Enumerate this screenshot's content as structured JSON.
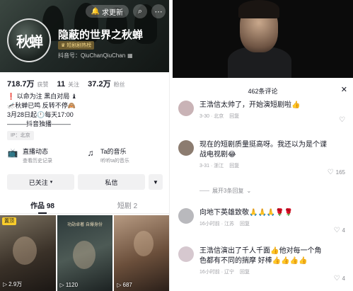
{
  "profile": {
    "top_pill": "求更新",
    "name": "隐蔽的世界之秋蝉",
    "avatar_text": "秋蝉",
    "badge": "短剧剧热榜",
    "douyin_id": "抖音号：QiuChanQiuChan",
    "stats": [
      {
        "value": "718.7万",
        "label": "获赞"
      },
      {
        "value": "11",
        "label": "关注"
      },
      {
        "value": "37.2万",
        "label": "粉丝"
      }
    ],
    "bio": [
      "❗ 以命为注 黑白对局 ♝",
      "🦟秋蝉已鸣 反转不停🙈",
      "3月28日起🕛每天17:00",
      "———抖音独播———"
    ],
    "ip": "IP：北京",
    "features": [
      {
        "title": "直播动态",
        "sub": "查看历史记录"
      },
      {
        "title": "Ta的音乐",
        "sub": "听听ta的音乐"
      }
    ],
    "buttons": {
      "follow": "已关注",
      "message": "私信"
    },
    "tabs": [
      {
        "label": "作品 98"
      },
      {
        "label": "短剧 2"
      }
    ],
    "videos": [
      {
        "pinned": "置顶",
        "plays": "2.9万"
      },
      {
        "caption": "功勋卓著 自爆身份",
        "plays": "1120"
      },
      {
        "plays": "687"
      }
    ]
  },
  "comments": {
    "header": "462条评论",
    "items": [
      {
        "text": "王浩信太帅了，开始演短剧啦👍",
        "time": "3-30",
        "location": "北京",
        "reply": "回复",
        "likes": "",
        "avatar_color": "#c9b3b6"
      },
      {
        "text": "现在的短剧质量挺高呀。我还以为是个谍战电视剧😂",
        "time": "3-31",
        "location": "浙江",
        "reply": "回复",
        "likes": "165",
        "avatar_color": "#8c7c70"
      },
      {
        "text": "向地下英雄致敬🙏🙏🙏🌹🌹",
        "time": "16小时前",
        "location": "江苏",
        "reply": "回复",
        "likes": "4",
        "avatar_color": "#b9b9bd"
      },
      {
        "text": "王浩信演出了千人千面👍他对每一个角色都有不同的揣摩 好棒👍👍👍👍",
        "time": "16小时前",
        "location": "辽宁",
        "reply": "回复",
        "likes": "4",
        "avatar_color": "#d6c8cf"
      }
    ],
    "expand": "展开3条回复"
  },
  "colors": {
    "pin": "#facd2b",
    "text": "#161823",
    "muted": "#8a8b91"
  }
}
